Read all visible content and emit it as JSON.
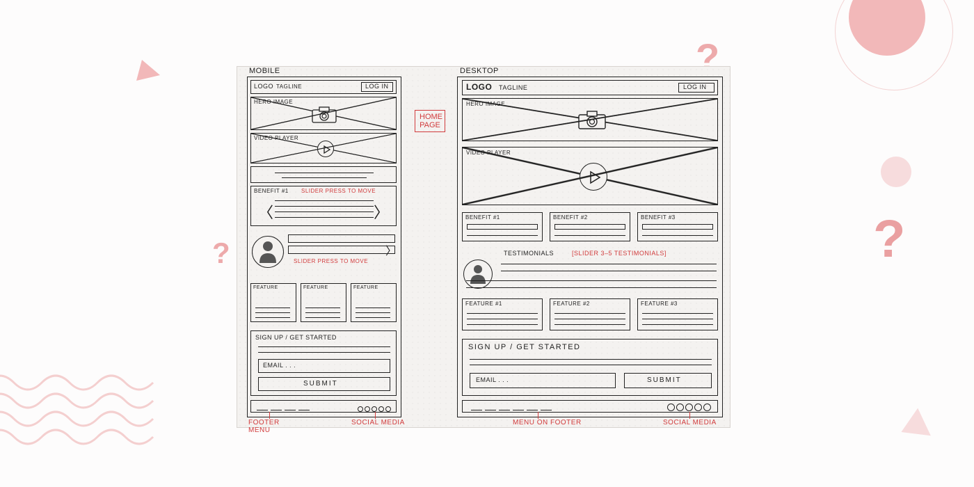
{
  "labels": {
    "mobile": "MOBILE",
    "desktop": "DESKTOP",
    "logo": "LOGO",
    "tagline": "TAGLINE",
    "login": "LOG IN",
    "hero": "HERO IMAGE",
    "video": "VIDEO PLAYER",
    "benefit1": "BENEFIT #1",
    "benefit2": "BENEFIT #2",
    "benefit3": "BENEFIT #3",
    "testimonials": "TESTIMONIALS",
    "feature": "FEATURE",
    "feature1": "FEATURE #1",
    "feature2": "FEATURE #2",
    "feature3": "FEATURE #3",
    "signup": "SIGN UP / GET STARTED",
    "email": "EMAIL . . .",
    "submit": "SUBMIT"
  },
  "annotations": {
    "homepage": "HOME PAGE",
    "slider_press": "SLIDER  PRESS TO MOVE",
    "slider_press2": "SLIDER PRESS TO MOVE",
    "slider_testimonials": "[SLIDER  3–5 TESTIMONIALS]",
    "footer_menu": "FOOTER MENU",
    "menu_on_footer": "MENU ON FOOTER",
    "social_media": "SOCIAL MEDIA"
  },
  "decor": {
    "question_mark": "?"
  }
}
